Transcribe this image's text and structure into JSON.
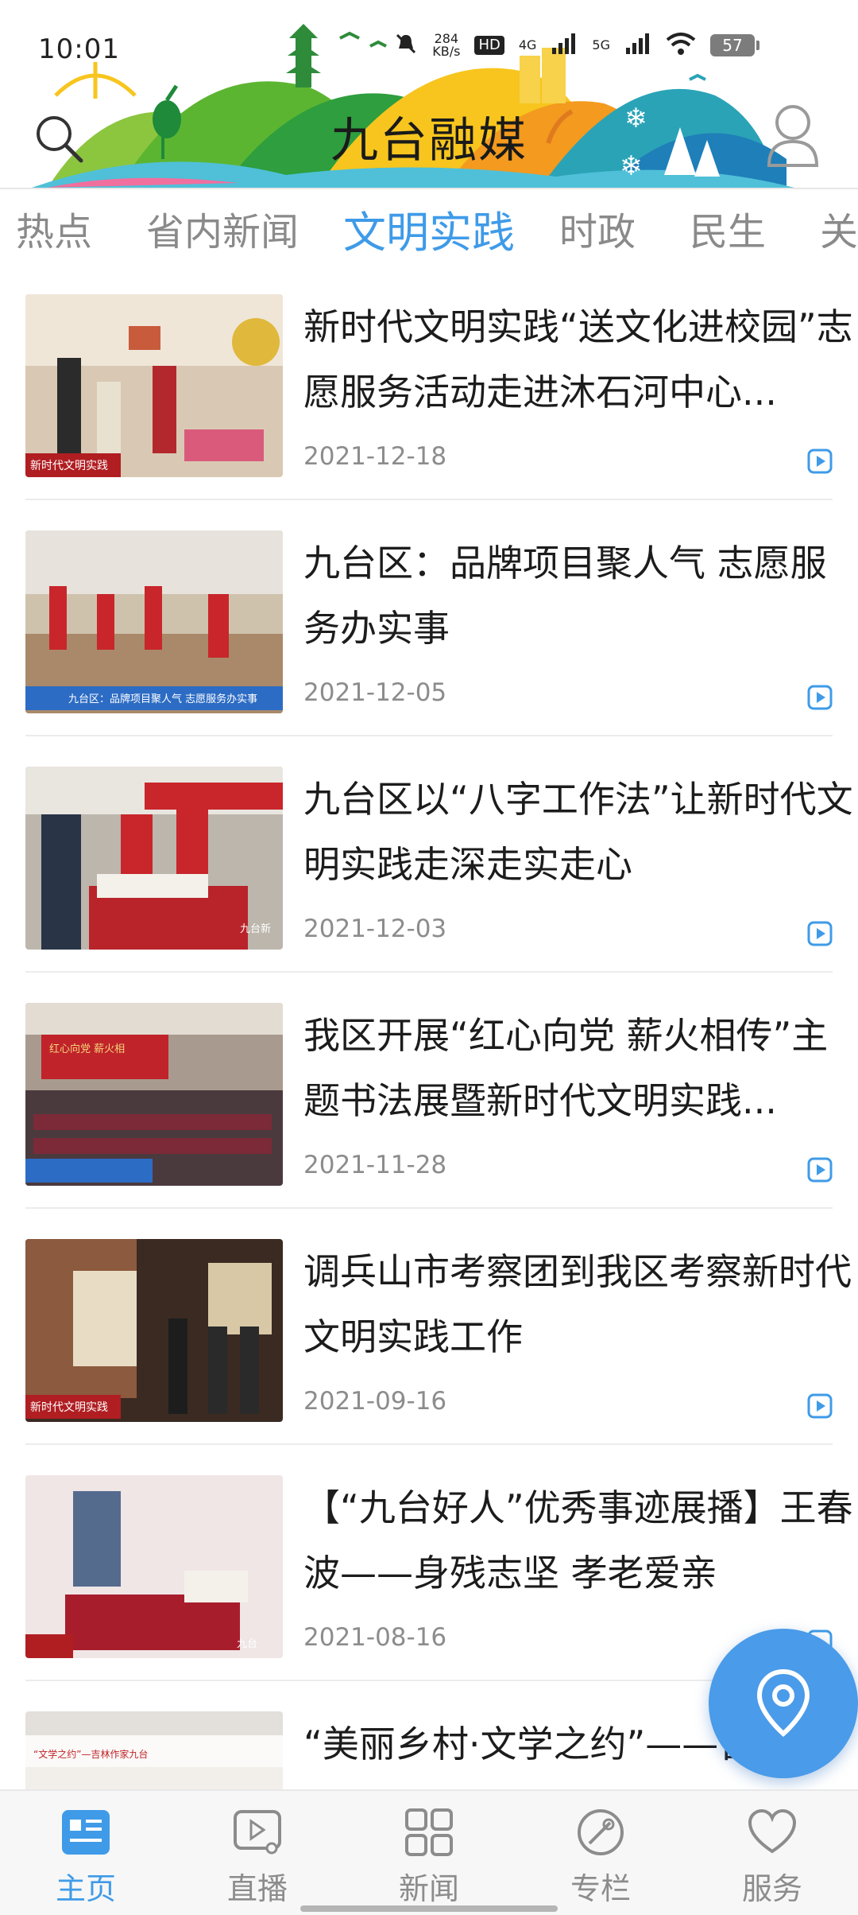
{
  "status_bar": {
    "time": "10:01",
    "net_speed": "284",
    "net_unit": "KB/s",
    "hd": "HD",
    "sim": "1 2",
    "signal_1": "4G",
    "signal_2": "5G",
    "battery": "57"
  },
  "header": {
    "title": "九台融媒",
    "search_icon": "search-icon",
    "user_icon": "user-icon"
  },
  "tabs": [
    {
      "label": "热点",
      "active": false
    },
    {
      "label": "省内新闻",
      "active": false
    },
    {
      "label": "文明实践",
      "active": true
    },
    {
      "label": "时政",
      "active": false
    },
    {
      "label": "民生",
      "active": false
    },
    {
      "label": "关",
      "active": false
    }
  ],
  "news": [
    {
      "title": "新时代文明实践“送文化进校园”志愿服务活动走进沐石河中心...",
      "date": "2021-12-18",
      "thumb_caption": "新时代文明实践"
    },
    {
      "title": "九台区：品牌项目聚人气 志愿服务办实事",
      "date": "2021-12-05",
      "thumb_caption": "九台区：品牌项目聚人气 志愿服务办实事"
    },
    {
      "title": "九台区以“八字工作法”让新时代文明实践走深走实走心",
      "date": "2021-12-03",
      "thumb_caption": "九台新"
    },
    {
      "title": "我区开展“红心向党 薪火相传”主题书法展暨新时代文明实践...",
      "date": "2021-11-28",
      "thumb_caption": "红心向党 薪火相"
    },
    {
      "title": "调兵山市考察团到我区考察新时代文明实践工作",
      "date": "2021-09-16",
      "thumb_caption": "新时代文明实践"
    },
    {
      "title": "【“九台好人”优秀事迹展播】王春波——身残志坚 孝老爱亲",
      "date": "2021-08-16",
      "thumb_caption": "九台"
    },
    {
      "title": "“美丽乡村·文学之约”——吉林作",
      "date": "",
      "thumb_caption": "“文学之约”—吉林作家九台"
    }
  ],
  "bottom_nav": [
    {
      "label": "主页",
      "icon": "home-news-icon",
      "active": true
    },
    {
      "label": "直播",
      "icon": "live-play-icon",
      "active": false
    },
    {
      "label": "新闻",
      "icon": "grid-icon",
      "active": false
    },
    {
      "label": "专栏",
      "icon": "column-icon",
      "active": false
    },
    {
      "label": "服务",
      "icon": "heart-icon",
      "active": false
    }
  ],
  "colors": {
    "accent": "#3f9be8",
    "fab": "#4a9be9",
    "text": "#1c1c1c",
    "muted": "#8c8c8c"
  }
}
